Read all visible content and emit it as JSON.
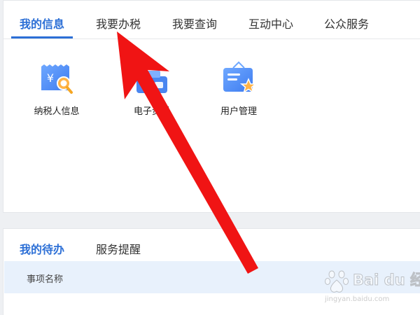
{
  "top_tabs": [
    {
      "label": "我的信息",
      "active": true
    },
    {
      "label": "我要办税",
      "active": false
    },
    {
      "label": "我要查询",
      "active": false
    },
    {
      "label": "互动中心",
      "active": false
    },
    {
      "label": "公众服务",
      "active": false
    }
  ],
  "features": [
    {
      "label": "纳税人信息",
      "icon": "taxpayer-info-icon"
    },
    {
      "label": "电子资料",
      "icon": "electronic-document-icon"
    },
    {
      "label": "用户管理",
      "icon": "user-management-icon"
    }
  ],
  "bottom_tabs": [
    {
      "label": "我的待办",
      "active": true
    },
    {
      "label": "服务提醒",
      "active": false
    }
  ],
  "table": {
    "columns": [
      "事项名称"
    ]
  },
  "watermark": {
    "text": "Bai du 经验",
    "url": "jingyan.baidu.com"
  },
  "colors": {
    "accent": "#2c6fd6",
    "arrow": "#f01414",
    "table_header_bg": "#e8f1fc"
  }
}
